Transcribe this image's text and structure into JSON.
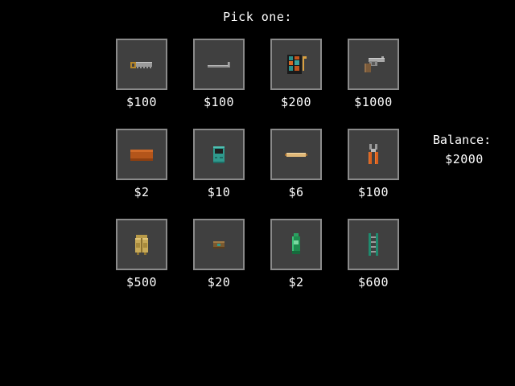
{
  "prompt": "Pick one:",
  "balance": {
    "label": "Balance:",
    "value": "$2000"
  },
  "items": [
    {
      "icon": "saw-icon",
      "price": "$100"
    },
    {
      "icon": "crowbar-icon",
      "price": "$100"
    },
    {
      "icon": "toolkit-icon",
      "price": "$200"
    },
    {
      "icon": "revolver-icon",
      "price": "$1000"
    },
    {
      "icon": "wooden-plank-icon",
      "price": "$2"
    },
    {
      "icon": "radio-icon",
      "price": "$10"
    },
    {
      "icon": "bandage-icon",
      "price": "$6"
    },
    {
      "icon": "pliers-icon",
      "price": "$100"
    },
    {
      "icon": "backpack-icon",
      "price": "$500"
    },
    {
      "icon": "food-can-icon",
      "price": "$20"
    },
    {
      "icon": "bottle-icon",
      "price": "$2"
    },
    {
      "icon": "ladder-icon",
      "price": "$600"
    }
  ],
  "colors": {
    "background": "#000000",
    "tile_fill": "#404040",
    "tile_border": "#8a8a8a",
    "text": "#ffffff"
  }
}
